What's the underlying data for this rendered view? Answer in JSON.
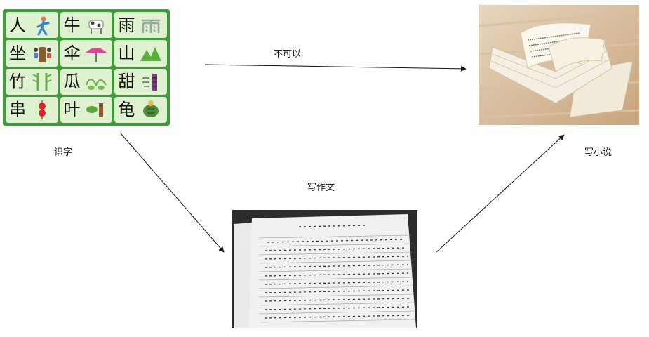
{
  "labels": {
    "recognize": "识字",
    "cannot": "不可以",
    "write_essay": "写作文",
    "write_novel": "写小说"
  },
  "char_card": {
    "cells": [
      {
        "char": "人",
        "icon": "person-icon"
      },
      {
        "char": "牛",
        "icon": "cow-icon"
      },
      {
        "char": "雨",
        "icon": "rain-icon"
      },
      {
        "char": "坐",
        "icon": "sitting-icon"
      },
      {
        "char": "伞",
        "icon": "umbrella-icon"
      },
      {
        "char": "山",
        "icon": "mountain-icon"
      },
      {
        "char": "竹",
        "icon": "bamboo-icon"
      },
      {
        "char": "瓜",
        "icon": "melon-icon"
      },
      {
        "char": "甜",
        "icon": "sugarcane-icon"
      },
      {
        "char": "串",
        "icon": "skewer-icon"
      },
      {
        "char": "叶",
        "icon": "leaf-icon"
      },
      {
        "char": "龟",
        "icon": "turtle-icon"
      }
    ],
    "background": "#3f9a3a",
    "cell_color": "#dff2cf"
  },
  "photos": {
    "book": "open-book-photo",
    "essay": "handwritten-composition-photo"
  }
}
